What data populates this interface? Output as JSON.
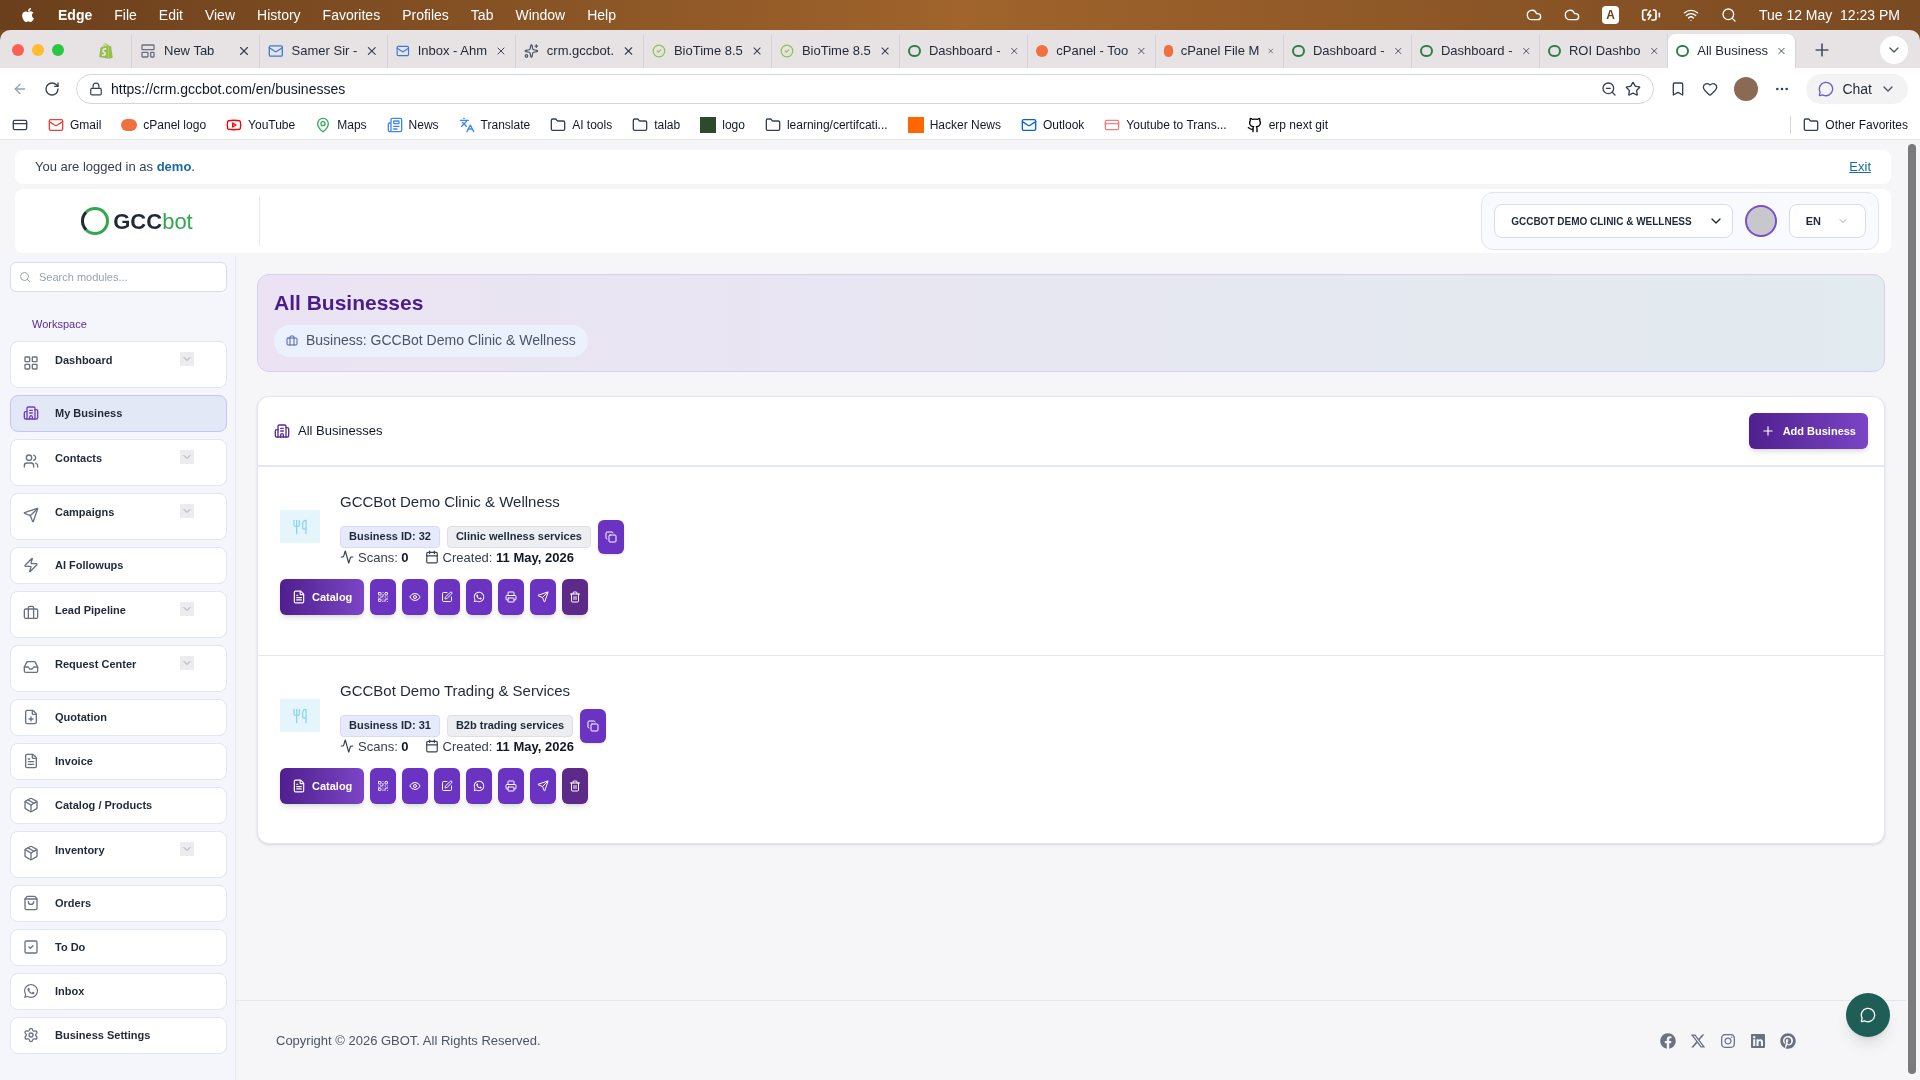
{
  "menubar": {
    "app": "Edge",
    "menus": [
      "File",
      "Edit",
      "View",
      "History",
      "Favorites",
      "Profiles",
      "Tab",
      "Window",
      "Help"
    ],
    "input_source": "A",
    "clock": "Tue 12 May  12:23 PM"
  },
  "browser": {
    "tabs": [
      {
        "kind": "shop",
        "selected": false
      },
      {
        "kind": "page",
        "title": "New Tab",
        "selected": false
      },
      {
        "kind": "mail",
        "title": "Samer Sir -",
        "selected": false
      },
      {
        "kind": "mail",
        "title": "Inbox - Ahm",
        "selected": false
      },
      {
        "kind": "ai",
        "title": "crm.gccbot.",
        "selected": false
      },
      {
        "kind": "check",
        "title": "BioTime 8.5",
        "selected": false
      },
      {
        "kind": "check",
        "title": "BioTime 8.5",
        "selected": false
      },
      {
        "kind": "g3",
        "title": "Dashboard -",
        "selected": false
      },
      {
        "kind": "cpanel",
        "title": "cPanel - Too",
        "selected": false
      },
      {
        "kind": "cpanel",
        "title": "cPanel File M",
        "selected": false
      },
      {
        "kind": "g3",
        "title": "Dashboard -",
        "selected": false
      },
      {
        "kind": "g3",
        "title": "Dashboard -",
        "selected": false
      },
      {
        "kind": "g3",
        "title": "ROI Dashbo",
        "selected": false
      },
      {
        "kind": "g3",
        "title": "All Business",
        "selected": true
      }
    ],
    "url": "https://crm.gccbot.com/en/businesses",
    "chat": "Chat",
    "bookmarks": [
      {
        "kind": "gmail",
        "label": "Gmail"
      },
      {
        "kind": "cpanel",
        "label": "cPanel logo"
      },
      {
        "kind": "youtube",
        "label": "YouTube"
      },
      {
        "kind": "maps",
        "label": "Maps"
      },
      {
        "kind": "news",
        "label": "News"
      },
      {
        "kind": "translate",
        "label": "Translate"
      },
      {
        "kind": "folder",
        "label": "AI tools"
      },
      {
        "kind": "folder",
        "label": "talab"
      },
      {
        "kind": "logo",
        "label": "logo"
      },
      {
        "kind": "folder",
        "label": "learning/certifcati..."
      },
      {
        "kind": "hn",
        "label": "Hacker News"
      },
      {
        "kind": "outlook",
        "label": "Outlook"
      },
      {
        "kind": "yt2",
        "label": "Youtube to Trans..."
      },
      {
        "kind": "github",
        "label": "erp next git"
      }
    ],
    "other_favorites": "Other Favorites"
  },
  "banner": {
    "text": "You are logged in as **demo**.",
    "exit": "Exit"
  },
  "header": {
    "logo_dark": "GCC",
    "logo_green": "bot",
    "business_select": "GCCBOT DEMO CLINIC & WELLNESS",
    "language": "EN"
  },
  "sidebar": {
    "search_placeholder": "Search modules...",
    "section": "Workspace",
    "items": [
      {
        "kind": "grid",
        "label": "Dashboard",
        "selected": false,
        "expandable": true
      },
      {
        "kind": "building",
        "label": "My Business",
        "selected": true,
        "expandable": false
      },
      {
        "kind": "users",
        "label": "Contacts",
        "selected": false,
        "expandable": true
      },
      {
        "kind": "send",
        "label": "Campaigns",
        "selected": false,
        "expandable": true
      },
      {
        "kind": "zap",
        "label": "AI Followups",
        "selected": false,
        "expandable": false
      },
      {
        "kind": "briefcase",
        "label": "Lead Pipeline",
        "selected": false,
        "expandable": true
      },
      {
        "kind": "inbox",
        "label": "Request Center",
        "selected": false,
        "expandable": true
      },
      {
        "kind": "fileplus",
        "label": "Quotation",
        "selected": false,
        "expandable": false
      },
      {
        "kind": "file",
        "label": "Invoice",
        "selected": false,
        "expandable": false
      },
      {
        "kind": "package",
        "label": "Catalog / Products",
        "selected": false,
        "expandable": false
      },
      {
        "kind": "package",
        "label": "Inventory",
        "selected": false,
        "expandable": true
      },
      {
        "kind": "bag",
        "label": "Orders",
        "selected": false,
        "expandable": false
      },
      {
        "kind": "check",
        "label": "To Do",
        "selected": false,
        "expandable": false
      },
      {
        "kind": "whatsapp",
        "label": "Inbox",
        "selected": false,
        "expandable": false
      },
      {
        "kind": "gear",
        "label": "Business Settings",
        "selected": false,
        "expandable": false
      }
    ]
  },
  "page": {
    "title": "All Businesses",
    "context_badge": "Business: GCCBot Demo Clinic & Wellness"
  },
  "list": {
    "title": "All Businesses",
    "add_button": "Add Business",
    "businesses": [
      {
        "name": "GCCBot Demo Clinic & Wellness",
        "id_badge": "Business ID: 32",
        "category": "Clinic wellness services",
        "scans": "Scans: **0**",
        "created": "Created: **11 May, 2026**",
        "catalog": "Catalog"
      },
      {
        "name": "GCCBot Demo Trading & Services",
        "id_badge": "Business ID: 31",
        "category": "B2b trading services",
        "scans": "Scans: **0**",
        "created": "Created: **11 May, 2026**",
        "catalog": "Catalog"
      }
    ]
  },
  "footer": {
    "copyright": "Copyright © 2026 GBOT. All Rights Reserved."
  }
}
